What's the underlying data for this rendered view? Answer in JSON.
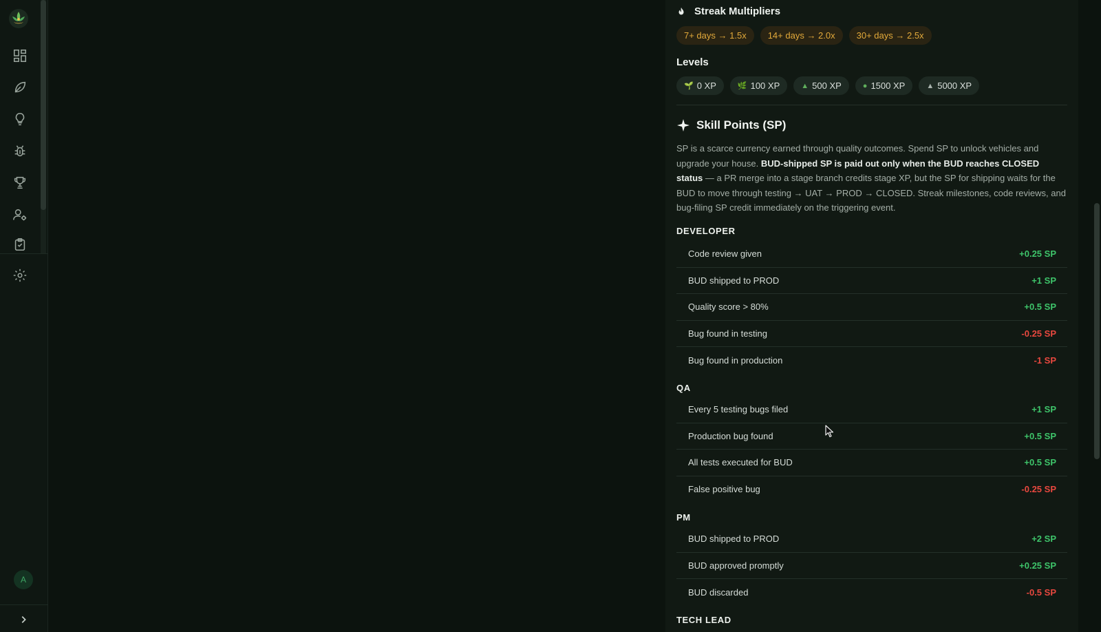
{
  "sidebar": {
    "logo": "lotus-logo",
    "items": [
      {
        "icon": "dashboard-grid-icon",
        "label": ""
      },
      {
        "icon": "leaf-icon",
        "label": ""
      },
      {
        "icon": "lightbulb-icon",
        "label": ""
      },
      {
        "icon": "bug-icon",
        "label": ""
      },
      {
        "icon": "trophy-icon",
        "label": ""
      },
      {
        "icon": "user-settings-icon",
        "label": ""
      },
      {
        "icon": "clipboard-check-icon",
        "label": ""
      },
      {
        "icon": "gear-icon",
        "label": ""
      }
    ],
    "avatar_initial": "A",
    "expand_icon": "chevron-right-icon"
  },
  "streak": {
    "title": "Streak Multipliers",
    "icon": "flame-icon",
    "pills": [
      "7+ days → 1.5x",
      "14+ days → 2.0x",
      "30+ days → 2.5x"
    ]
  },
  "levels": {
    "title": "Levels",
    "pills": [
      {
        "icon": "sprout-icon",
        "label": "0 XP"
      },
      {
        "icon": "herb-icon",
        "label": "100 XP"
      },
      {
        "icon": "small-tree-icon",
        "label": "500 XP"
      },
      {
        "icon": "tree-icon",
        "label": "1500 XP"
      },
      {
        "icon": "mountain-icon",
        "label": "5000 XP"
      }
    ]
  },
  "skill_points": {
    "title": "Skill Points (SP)",
    "icon": "sparkle-icon",
    "desc_intro": "SP is a scarce currency earned through quality outcomes. Spend SP to unlock vehicles and upgrade your house. ",
    "desc_bold": "BUD-shipped SP is paid out only when the BUD reaches CLOSED status",
    "desc_rest": " — a PR merge into a stage branch credits stage XP, but the SP for shipping waits for the BUD to move through testing → UAT → PROD → CLOSED. Streak milestones, code reviews, and bug-filing SP credit immediately on the triggering event."
  },
  "roles": [
    {
      "name": "DEVELOPER",
      "rules": [
        {
          "label": "Code review given",
          "value": "+0.25 SP",
          "sign": "pos"
        },
        {
          "label": "BUD shipped to PROD",
          "value": "+1 SP",
          "sign": "pos"
        },
        {
          "label": "Quality score > 80%",
          "value": "+0.5 SP",
          "sign": "pos"
        },
        {
          "label": "Bug found in testing",
          "value": "-0.25 SP",
          "sign": "neg"
        },
        {
          "label": "Bug found in production",
          "value": "-1 SP",
          "sign": "neg"
        }
      ]
    },
    {
      "name": "QA",
      "rules": [
        {
          "label": "Every 5 testing bugs filed",
          "value": "+1 SP",
          "sign": "pos"
        },
        {
          "label": "Production bug found",
          "value": "+0.5 SP",
          "sign": "pos"
        },
        {
          "label": "All tests executed for BUD",
          "value": "+0.5 SP",
          "sign": "pos"
        },
        {
          "label": "False positive bug",
          "value": "-0.25 SP",
          "sign": "neg"
        }
      ]
    },
    {
      "name": "PM",
      "rules": [
        {
          "label": "BUD shipped to PROD",
          "value": "+2 SP",
          "sign": "pos"
        },
        {
          "label": "BUD approved promptly",
          "value": "+0.25 SP",
          "sign": "pos"
        },
        {
          "label": "BUD discarded",
          "value": "-0.5 SP",
          "sign": "neg"
        }
      ]
    },
    {
      "name": "TECH LEAD",
      "rules": []
    }
  ],
  "colors": {
    "positive": "#3ec46a",
    "negative": "#e8483f",
    "streak_accent": "#e2a93a"
  }
}
